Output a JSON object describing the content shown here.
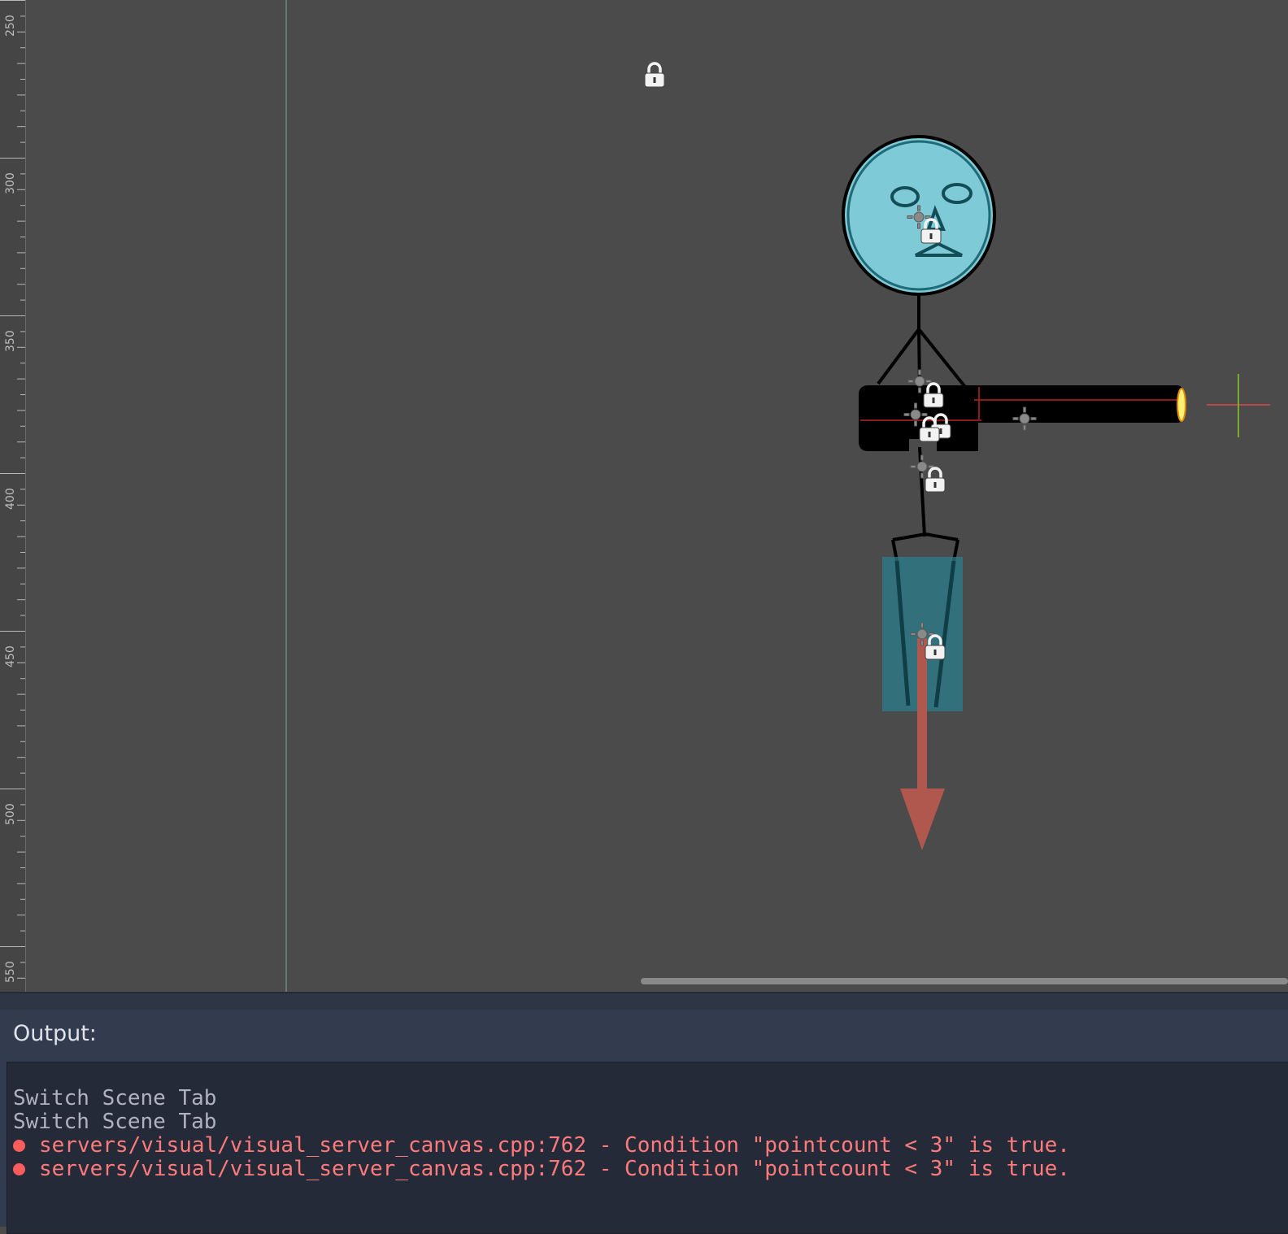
{
  "ruler": {
    "ticks": [
      {
        "label": "250"
      },
      {
        "label": "300"
      },
      {
        "label": "350"
      },
      {
        "label": "400"
      },
      {
        "label": "450"
      },
      {
        "label": "500"
      },
      {
        "label": "550"
      }
    ]
  },
  "colors": {
    "canvas_bg": "#4b4b4b",
    "head_fill": "#7ecad6",
    "collision_fill": "#2a7d8c",
    "arrow": "#b0584d",
    "error_text": "#ff7a7a",
    "panel_bg": "#333b4f",
    "log_bg": "#252a39"
  },
  "output": {
    "label": "Output:",
    "lines": [
      {
        "type": "info",
        "text": "Switch Scene Tab"
      },
      {
        "type": "info",
        "text": "Switch Scene Tab"
      },
      {
        "type": "error",
        "text": "servers/visual/visual_server_canvas.cpp:762 - Condition \"pointcount < 3\" is true."
      },
      {
        "type": "error",
        "text": "servers/visual/visual_server_canvas.cpp:762 - Condition \"pointcount < 3\" is true."
      }
    ]
  }
}
